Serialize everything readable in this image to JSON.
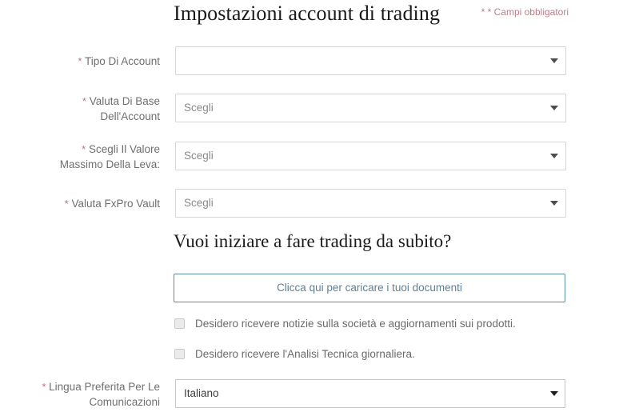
{
  "header": {
    "title": "Impostazioni account di trading",
    "required_note": "* * Campi obbligatori"
  },
  "form": {
    "fields": [
      {
        "label_line1": "Tipo Di Account",
        "label_line2": "",
        "required_marker": "*",
        "value": "",
        "control": "select"
      },
      {
        "label_line1": "Valuta Di Base",
        "label_line2": "Dell'Account",
        "required_marker": "*",
        "value": "Scegli",
        "control": "select"
      },
      {
        "label_line1": "Scegli Il Valore",
        "label_line2": "Massimo Della Leva:",
        "required_marker": "*",
        "value": "Scegli",
        "control": "select"
      },
      {
        "label_line1": "Valuta FxPro Vault",
        "label_line2": "",
        "required_marker": "*",
        "value": "Scegli",
        "control": "select"
      }
    ],
    "language_field": {
      "label_line1": "Lingua Preferita Per Le",
      "label_line2": "Comunicazioni",
      "required_marker": "*",
      "value": "Italiano",
      "control": "select"
    }
  },
  "start_trading": {
    "heading": "Vuoi iniziare a fare trading da subito?",
    "upload_button_label": "Clicca qui per caricare i tuoi documenti"
  },
  "consents": [
    {
      "label": "Desidero ricevere notizie sulla società e aggiornamenti sui prodotti.",
      "checked": false
    },
    {
      "label": "Desidero ricevere l'Analisi Tecnica giornaliera.",
      "checked": false
    }
  ],
  "colors": {
    "required_star": "#c0707f",
    "required_note": "#bb7d89",
    "cta_border": "#5d8e9b",
    "cta_text": "#5f7f93",
    "label_text": "#6f6f6f",
    "select_border": "#d8d8d8",
    "heading_text": "#1a1a1a"
  },
  "icons": {
    "dropdown_caret": "chevron-down-icon",
    "checkbox": "checkbox-icon"
  }
}
